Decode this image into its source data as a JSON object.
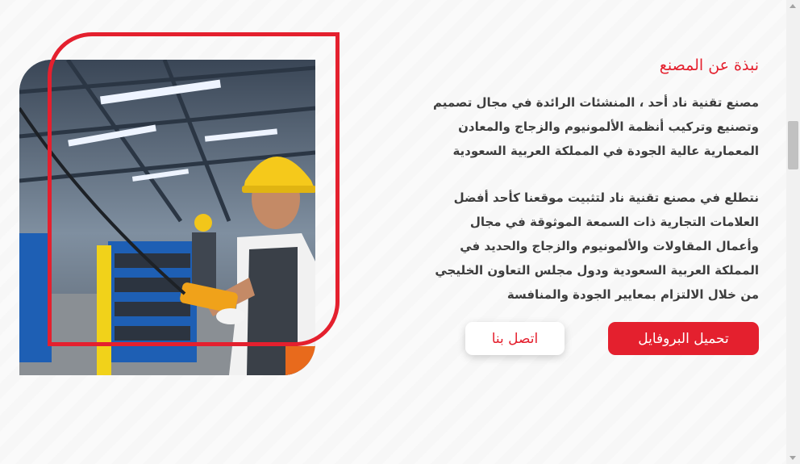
{
  "about": {
    "title": "نبذة عن المصنع",
    "paragraph1": "مصنع تقنية ناد أحد ، المنشئات الرائدة في مجال تصميم وتصنيع وتركيب أنظمة الألمونيوم والزجاج والمعادن المعمارية عالية الجودة في المملكة العربية السعودية",
    "paragraph2": "نتطلع في مصنع تقنية ناد لتثبيت موقعنا كأحد أفضل العلامات التجارية ذات السمعة الموثوقة في مجال وأعمال المقاولات والألمونيوم والزجاج والحديد في المملكة العربية السعودية ودول مجلس التعاون الخليجي من خلال الالتزام بمعايير الجودة والمنافسة"
  },
  "buttons": {
    "download_profile": "تحميل البروفايل",
    "contact_us": "اتصل بنا"
  },
  "colors": {
    "accent": "#e4202e"
  },
  "image": {
    "subject": "factory-worker-photo"
  }
}
